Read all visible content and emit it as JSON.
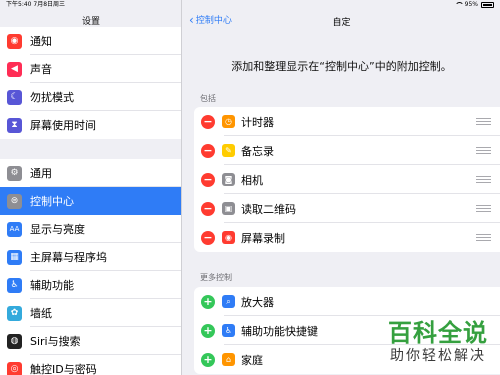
{
  "status_bar": {
    "time_date": "下午5:40  7月8日周三",
    "battery": "95%"
  },
  "sidebar": {
    "title": "设置",
    "group1": [
      {
        "label": "通知",
        "icon": "notifications-icon",
        "color": "#ff3b30",
        "glyph": "◉"
      },
      {
        "label": "声音",
        "icon": "sound-icon",
        "color": "#ff2d55",
        "glyph": "◀"
      },
      {
        "label": "勿扰模式",
        "icon": "moon-icon",
        "color": "#5856d6",
        "glyph": "☾"
      },
      {
        "label": "屏幕使用时间",
        "icon": "hourglass-icon",
        "color": "#5856d6",
        "glyph": "⧗"
      }
    ],
    "group2": [
      {
        "label": "通用",
        "icon": "gear-icon",
        "color": "#8e8e93",
        "glyph": "⚙"
      },
      {
        "label": "控制中心",
        "icon": "control-center-icon",
        "color": "#8e8e93",
        "glyph": "⊜",
        "selected": true
      },
      {
        "label": "显示与亮度",
        "icon": "display-icon",
        "color": "#2f7cf6",
        "glyph": "AA"
      },
      {
        "label": "主屏幕与程序坞",
        "icon": "home-screen-icon",
        "color": "#2f7cf6",
        "glyph": "▦"
      },
      {
        "label": "辅助功能",
        "icon": "accessibility-icon",
        "color": "#2f7cf6",
        "glyph": "♿"
      },
      {
        "label": "墙纸",
        "icon": "wallpaper-icon",
        "color": "#34aadc",
        "glyph": "✿"
      },
      {
        "label": "Siri与搜索",
        "icon": "siri-icon",
        "color": "#222222",
        "glyph": "◍"
      },
      {
        "label": "触控ID与密码",
        "icon": "touch-id-icon",
        "color": "#ff3b30",
        "glyph": "◎"
      }
    ]
  },
  "main": {
    "back_label": "控制中心",
    "title": "自定",
    "hint": "添加和整理显示在“控制中心”中的附加控制。",
    "included_label": "包括",
    "included": [
      {
        "label": "计时器",
        "icon": "timer-icon",
        "color": "#ff9500",
        "glyph": "◷"
      },
      {
        "label": "备忘录",
        "icon": "notes-icon",
        "color": "#ffcc00",
        "glyph": "✎"
      },
      {
        "label": "相机",
        "icon": "camera-icon",
        "color": "#8e8e93",
        "glyph": "◙"
      },
      {
        "label": "读取二维码",
        "icon": "qr-code-icon",
        "color": "#8e8e93",
        "glyph": "▣"
      },
      {
        "label": "屏幕录制",
        "icon": "screen-record-icon",
        "color": "#ff3b30",
        "glyph": "◉"
      }
    ],
    "more_label": "更多控制",
    "more": [
      {
        "label": "放大器",
        "icon": "magnifier-icon",
        "color": "#2f7cf6",
        "glyph": "⌕"
      },
      {
        "label": "辅助功能快捷键",
        "icon": "accessibility-shortcut-icon",
        "color": "#2f7cf6",
        "glyph": "♿"
      },
      {
        "label": "家庭",
        "icon": "home-icon",
        "color": "#ff9500",
        "glyph": "⌂"
      }
    ]
  },
  "watermark": {
    "title": "百科全说",
    "subtitle": "助你轻松解决"
  }
}
